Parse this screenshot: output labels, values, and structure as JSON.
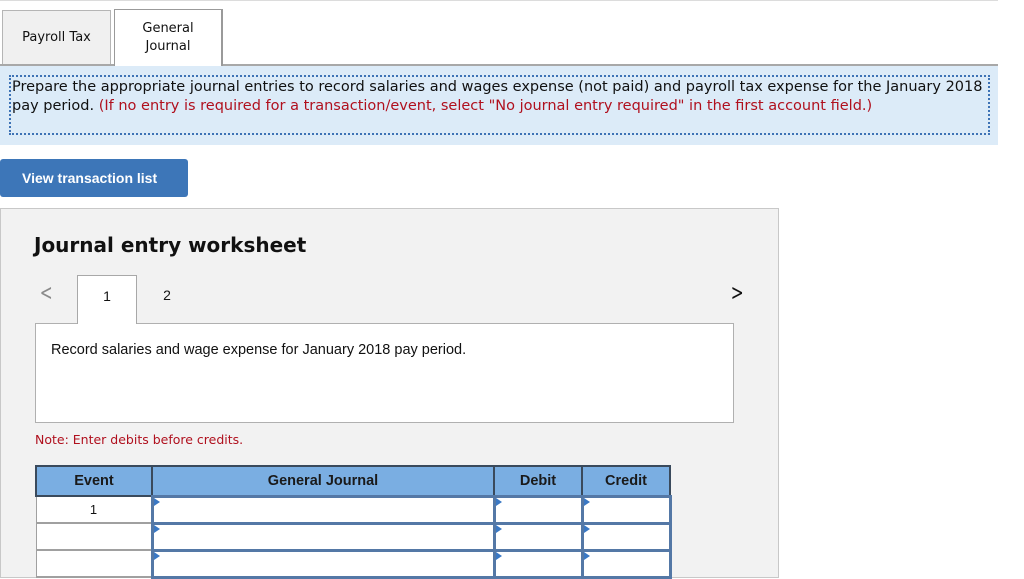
{
  "tabs": [
    {
      "label": "Payroll Tax",
      "active": false
    },
    {
      "label": "General\nJournal",
      "label_line1": "General",
      "label_line2": "Journal",
      "active": true
    }
  ],
  "instructions": {
    "main": "Prepare the appropriate journal entries to record salaries and wages expense (not paid) and payroll tax expense for the January 2018 pay period.",
    "note": "(If no entry is required for a transaction/event, select \"No journal entry required\" in the first account field.)"
  },
  "view_transaction_button": "View transaction list",
  "worksheet": {
    "title": "Journal entry worksheet",
    "prev_icon": "chevron-left-icon",
    "next_icon": "chevron-right-icon",
    "steps": [
      "1",
      "2"
    ],
    "active_step": "1",
    "description": "Record salaries and wage expense for January 2018 pay period.",
    "note": "Note: Enter debits before credits.",
    "table": {
      "headers": [
        "Event",
        "General Journal",
        "Debit",
        "Credit"
      ],
      "rows": [
        {
          "event": "1",
          "account": "",
          "debit": "",
          "credit": ""
        },
        {
          "event": "",
          "account": "",
          "debit": "",
          "credit": ""
        },
        {
          "event": "",
          "account": "",
          "debit": "",
          "credit": ""
        }
      ]
    }
  },
  "colors": {
    "accent_blue": "#3d76b8",
    "instruction_bg": "#dcebf8",
    "instruction_red": "#b0101e",
    "table_header": "#7aaee2"
  }
}
